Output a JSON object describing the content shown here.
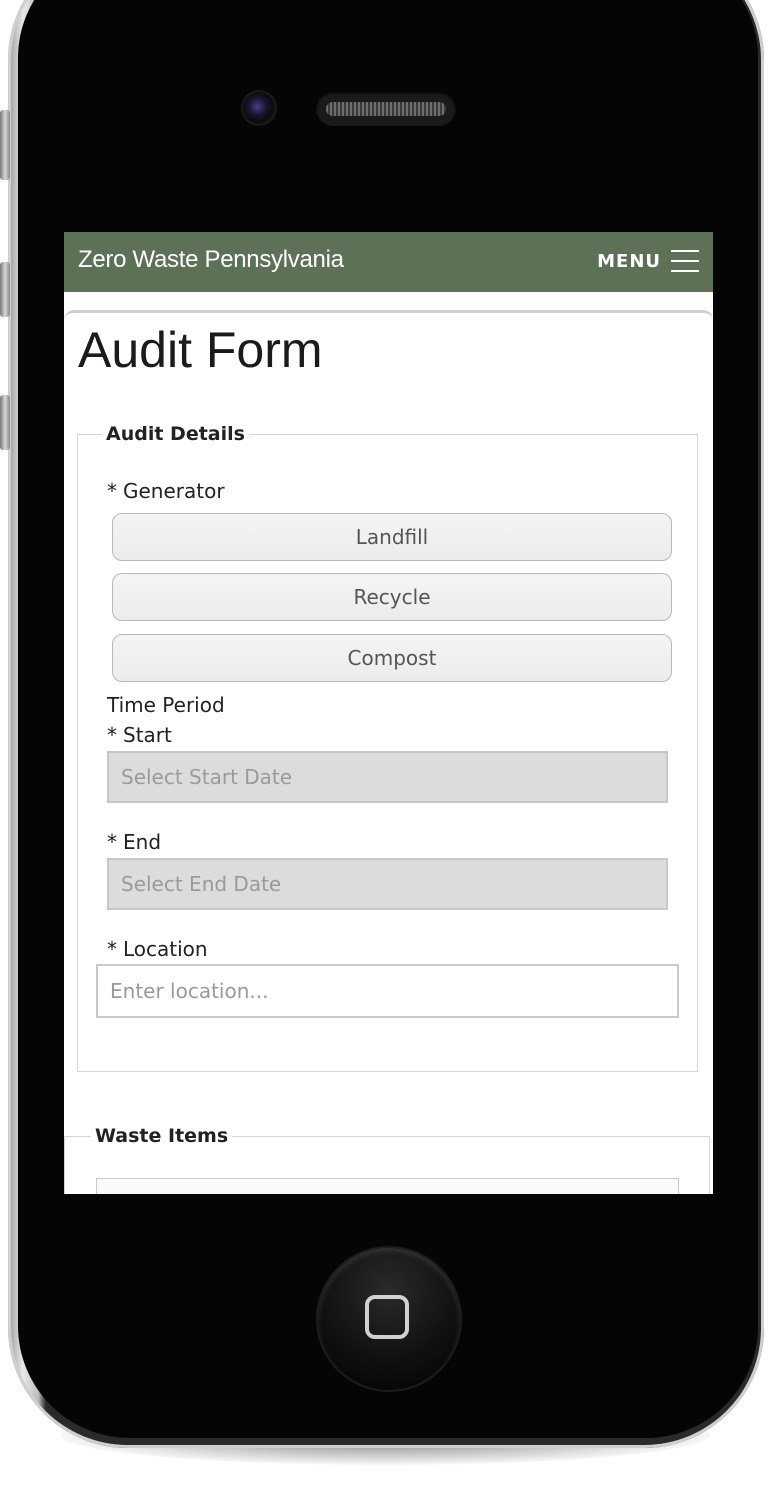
{
  "app": {
    "brand": "Zero Waste Pennsylvania",
    "menu_label": "MENU"
  },
  "page": {
    "title": "Audit Form"
  },
  "audit_details": {
    "legend": "Audit Details",
    "generator": {
      "required_marker": "*",
      "label": "Generator",
      "options": [
        "Landfill",
        "Recycle",
        "Compost"
      ]
    },
    "time_period_label": "Time Period",
    "start": {
      "required_marker": "*",
      "label": "Start",
      "placeholder": "Select Start Date"
    },
    "end": {
      "required_marker": "*",
      "label": "End",
      "placeholder": "Select End Date"
    },
    "location": {
      "required_marker": "*",
      "label": "Location",
      "placeholder": "Enter location..."
    }
  },
  "waste_items": {
    "legend": "Waste Items"
  },
  "colors": {
    "navbar": "#5c7156",
    "date_input_bg": "#dcdcdc"
  },
  "icons": {
    "menu": "hamburger-icon",
    "home": "home-square-icon"
  }
}
